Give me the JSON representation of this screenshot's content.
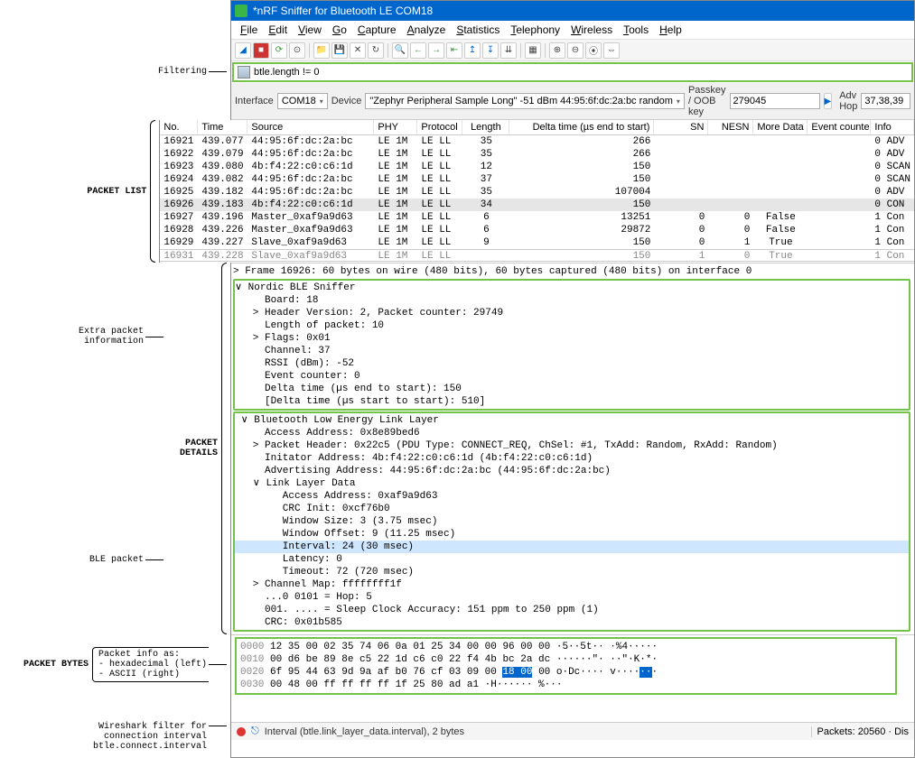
{
  "title": "*nRF Sniffer for Bluetooth LE COM18",
  "menu": [
    "File",
    "Edit",
    "View",
    "Go",
    "Capture",
    "Analyze",
    "Statistics",
    "Telephony",
    "Wireless",
    "Tools",
    "Help"
  ],
  "filter": {
    "text": "btle.length != 0"
  },
  "iface": {
    "interface_label": "Interface",
    "interface_value": "COM18",
    "device_label": "Device",
    "device_value": "\"Zephyr Peripheral Sample Long\"  -51 dBm  44:95:6f:dc:2a:bc  random",
    "passkey_label": "Passkey / OOB key",
    "passkey_value": "279045",
    "advhop_label": "Adv Hop",
    "advhop_value": "37,38,39"
  },
  "columns": [
    "No.",
    "Time",
    "Source",
    "PHY",
    "Protocol",
    "Length",
    "Delta time (µs end to start)",
    "SN",
    "NESN",
    "More Data",
    "Event counter",
    "Info"
  ],
  "packets": [
    {
      "no": "16921",
      "time": "439.077",
      "src": "44:95:6f:dc:2a:bc",
      "phy": "LE 1M",
      "prot": "LE LL",
      "len": "35",
      "dt": "266",
      "sn": "",
      "ne": "",
      "md": "",
      "ec": "",
      "info": "0 ADV"
    },
    {
      "no": "16922",
      "time": "439.079",
      "src": "44:95:6f:dc:2a:bc",
      "phy": "LE 1M",
      "prot": "LE LL",
      "len": "35",
      "dt": "266",
      "sn": "",
      "ne": "",
      "md": "",
      "ec": "",
      "info": "0 ADV"
    },
    {
      "no": "16923",
      "time": "439.080",
      "src": "4b:f4:22:c0:c6:1d",
      "phy": "LE 1M",
      "prot": "LE LL",
      "len": "12",
      "dt": "150",
      "sn": "",
      "ne": "",
      "md": "",
      "ec": "",
      "info": "0 SCAN"
    },
    {
      "no": "16924",
      "time": "439.082",
      "src": "44:95:6f:dc:2a:bc",
      "phy": "LE 1M",
      "prot": "LE LL",
      "len": "37",
      "dt": "150",
      "sn": "",
      "ne": "",
      "md": "",
      "ec": "",
      "info": "0 SCAN"
    },
    {
      "no": "16925",
      "time": "439.182",
      "src": "44:95:6f:dc:2a:bc",
      "phy": "LE 1M",
      "prot": "LE LL",
      "len": "35",
      "dt": "107004",
      "sn": "",
      "ne": "",
      "md": "",
      "ec": "",
      "info": "0 ADV"
    },
    {
      "no": "16926",
      "time": "439.183",
      "src": "4b:f4:22:c0:c6:1d",
      "phy": "LE 1M",
      "prot": "LE LL",
      "len": "34",
      "dt": "150",
      "sn": "",
      "ne": "",
      "md": "",
      "ec": "",
      "info": "0 CON",
      "sel": true
    },
    {
      "no": "16927",
      "time": "439.196",
      "src": "Master_0xaf9a9d63",
      "phy": "LE 1M",
      "prot": "LE LL",
      "len": "6",
      "dt": "13251",
      "sn": "0",
      "ne": "0",
      "md": "False",
      "ec": "",
      "info": "1 Con"
    },
    {
      "no": "16928",
      "time": "439.226",
      "src": "Master_0xaf9a9d63",
      "phy": "LE 1M",
      "prot": "LE LL",
      "len": "6",
      "dt": "29872",
      "sn": "0",
      "ne": "0",
      "md": "False",
      "ec": "",
      "info": "1 Con"
    },
    {
      "no": "16929",
      "time": "439.227",
      "src": "Slave_0xaf9a9d63",
      "phy": "LE 1M",
      "prot": "LE LL",
      "len": "9",
      "dt": "150",
      "sn": "0",
      "ne": "1",
      "md": "True",
      "ec": "",
      "info": "1 Con"
    }
  ],
  "packet_cut": {
    "no": "16931",
    "time": "439.228",
    "src": "Slave_0xaf9a9d63",
    "phy": "LE 1M",
    "prot": "LE LL",
    "len": "",
    "dt": "150",
    "sn": "1",
    "ne": "0",
    "md": "True",
    "ec": "",
    "info": "1 Con"
  },
  "details": {
    "frame_line": "> Frame 16926: 60 bytes on wire (480 bits), 60 bytes captured (480 bits) on interface 0",
    "nordic_header": "∨ Nordic BLE Sniffer",
    "nordic_lines": [
      "     Board: 18",
      "   > Header Version: 2, Packet counter: 29749",
      "     Length of packet: 10",
      "   > Flags: 0x01",
      "     Channel: 37",
      "     RSSI (dBm): -52",
      "     Event counter: 0",
      "     Delta time (µs end to start): 150",
      "     [Delta time (µs start to start): 510]"
    ],
    "ble_header": " ∨ Bluetooth Low Energy Link Layer",
    "ble_lines_top": [
      "     Access Address: 0x8e89bed6",
      "   > Packet Header: 0x22c5 (PDU Type: CONNECT_REQ, ChSel: #1, TxAdd: Random, RxAdd: Random)",
      "     Initator Address: 4b:f4:22:c0:c6:1d (4b:f4:22:c0:c6:1d)",
      "     Advertising Address: 44:95:6f:dc:2a:bc (44:95:6f:dc:2a:bc)",
      "   ∨ Link Layer Data",
      "        Access Address: 0xaf9a9d63",
      "        CRC Init: 0xcf76b0",
      "        Window Size: 3 (3.75 msec)",
      "        Window Offset: 9 (11.25 msec)"
    ],
    "ble_interval": "        Interval: 24 (30 msec)",
    "ble_lines_bot": [
      "        Latency: 0",
      "        Timeout: 72 (720 msec)",
      "   > Channel Map: ffffffff1f",
      "     ...0 0101 = Hop: 5",
      "     001. .... = Sleep Clock Accuracy: 151 ppm to 250 ppm (1)",
      "     CRC: 0x01b585"
    ]
  },
  "bytes": {
    "rows": [
      {
        "off": "0000",
        "hex": "12 35 00 02 35 74 06 0a  01 25 34 00 00 96 00 00",
        "asc": "·5··5t··  ·%4·····"
      },
      {
        "off": "0010",
        "hex": "00 d6 be 89 8e c5 22 1d  c6 c0 22 f4 4b bc 2a dc",
        "asc": "······\"·  ··\"·K·*·"
      },
      {
        "off": "0020",
        "hex": "6f 95 44 63 9d 9a af b0  76 cf 03 09 00 ",
        "hl": "18 00",
        "hex2": " 00",
        "asc": "o·Dc····  v····",
        "aschi": "··",
        "asc2": "·"
      },
      {
        "off": "0030",
        "hex": "00 48 00 ff ff ff ff 1f  25 80 ad a1",
        "asc": "·H······  %···"
      }
    ]
  },
  "status": {
    "field": "Interval (btle.link_layer_data.interval), 2 bytes",
    "packets": "Packets: 20560 · Dis"
  },
  "annotations": {
    "filtering": "Filtering",
    "packet_list": "PACKET LIST",
    "extra": "Extra packet\ninformation",
    "packet_details": "PACKET DETAILS",
    "ble_packet": "BLE packet",
    "packet_bytes_title": "PACKET BYTES",
    "packet_bytes_lines": "Packet info as:\n- hexadecimal (left)\n- ASCII (right)",
    "status_ann": "Wireshark filter for\nconnection interval\nbtle.connect.interval"
  }
}
